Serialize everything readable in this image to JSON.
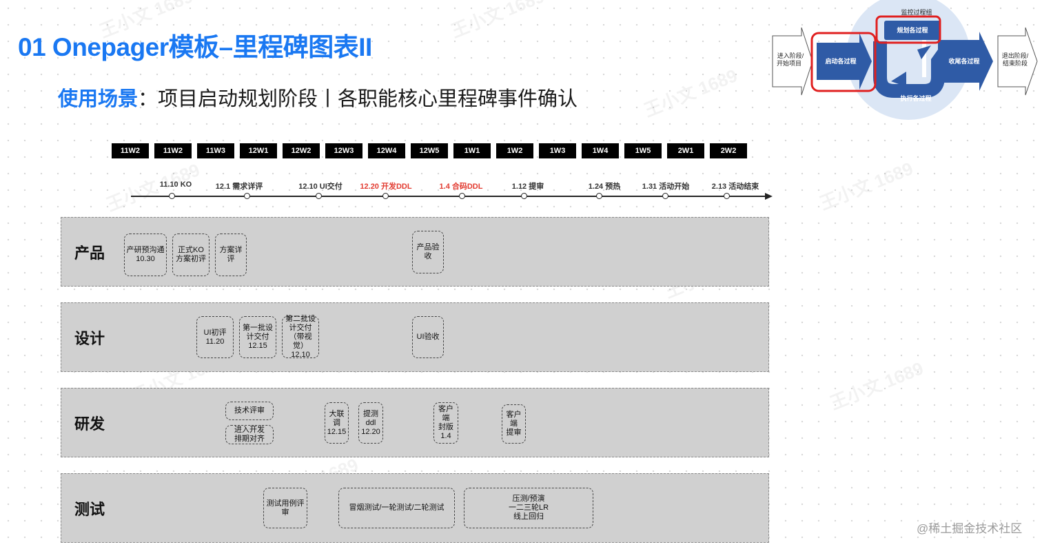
{
  "page": {
    "title": "01 Onepager模板–里程碑图表II",
    "subtitle_highlight": "使用场景",
    "subtitle_rest": "：项目启动规划阶段丨各职能核心里程碑事件确认",
    "footer": "@稀土掘金技术社区",
    "watermark": "王小文 1689"
  },
  "colors": {
    "title_blue": "#1a78f2",
    "red_milestone": "#e23b30",
    "lane_gray": "#d0d0d0",
    "process_blue": "#2f5ba6",
    "highlight_red": "#e02020"
  },
  "weeks": [
    "11W2",
    "11W2",
    "11W3",
    "12W1",
    "12W2",
    "12W3",
    "12W4",
    "12W5",
    "1W1",
    "1W2",
    "1W3",
    "1W4",
    "1W5",
    "2W1",
    "2W2"
  ],
  "milestones": [
    {
      "label": "11.10 KO",
      "red": false
    },
    {
      "label": "12.1 需求详评",
      "red": false
    },
    {
      "label": "12.10 UI交付",
      "red": false
    },
    {
      "label": "12.20 开发DDL",
      "red": true
    },
    {
      "label": "1.4 合码DDL",
      "red": true
    },
    {
      "label": "1.12 提审",
      "red": false
    },
    {
      "label": "1.24 预热",
      "red": false
    },
    {
      "label": "1.31 活动开始",
      "red": false
    },
    {
      "label": "2.13 活动结束",
      "red": false
    }
  ],
  "lanes": [
    {
      "name": "产品",
      "tasks": [
        "产研预沟通\n10.30",
        "正式KO\n方案初评",
        "方案详评",
        "产品验收"
      ]
    },
    {
      "name": "设计",
      "tasks": [
        "UI初评\n11.20",
        "第一批设\n计交付\n12.15",
        "第二批设\n计交付\n（带视\n觉）12.10",
        "UI验收"
      ]
    },
    {
      "name": "研发",
      "tasks": [
        "技术评审",
        "进入开发\n排期对齐",
        "大联调\n12.15",
        "提测\nddl\n12.20",
        "客户端\n封版\n1.4",
        "客户端\n提审"
      ]
    },
    {
      "name": "测试",
      "tasks": [
        "测试用例评\n审",
        "冒烟测试/一轮测试/二轮测试",
        "压测/预演\n一二三轮LR\n线上回归"
      ]
    }
  ],
  "process_diagram": {
    "enter": "进入阶段/\n开始项目",
    "initiate": "启动各过程",
    "monitor": "监控过程组",
    "plan": "规划各过程",
    "execute": "执行各过程",
    "close": "收尾各过程",
    "exit": "退出阶段/\n结束阶段"
  }
}
